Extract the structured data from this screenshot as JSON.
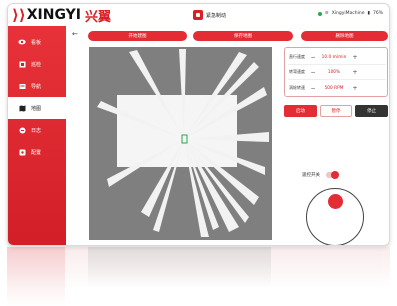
{
  "brand": {
    "logo_text": "XINGYI",
    "logo_cn": "兴翼"
  },
  "header": {
    "title": "紧急制动",
    "wifi_name": "XingyiMachine",
    "battery": "76%"
  },
  "sidebar": {
    "items": [
      {
        "label": "看板",
        "icon": "eye-icon"
      },
      {
        "label": "巡检",
        "icon": "inspect-icon"
      },
      {
        "label": "导航",
        "icon": "navigation-icon"
      },
      {
        "label": "地图",
        "icon": "map-icon"
      },
      {
        "label": "日志",
        "icon": "log-icon"
      },
      {
        "label": "配置",
        "icon": "settings-icon"
      }
    ],
    "active_index": 3
  },
  "toolbar": {
    "back_icon": "arrow-left-icon",
    "start_label": "开始建图",
    "save_label": "保存地图",
    "delete_label": "删除地图"
  },
  "params": {
    "rows": [
      {
        "label": "直行速度",
        "value": "10.0 m/min",
        "minus": "−",
        "plus": "+"
      },
      {
        "label": "转弯速度",
        "value": "100%",
        "minus": "−",
        "plus": "+"
      },
      {
        "label": "涡轮转速",
        "value": "500 RPM",
        "minus": "−",
        "plus": "+"
      }
    ]
  },
  "modes": {
    "a": "启动",
    "b": "暂停",
    "c": "停止"
  },
  "control": {
    "toggle_label": "遥控开关",
    "toggle_on": true
  },
  "colors": {
    "accent": "#e32c34",
    "map_bg": "#7f7f7f",
    "status_ok": "#2aa84a"
  }
}
